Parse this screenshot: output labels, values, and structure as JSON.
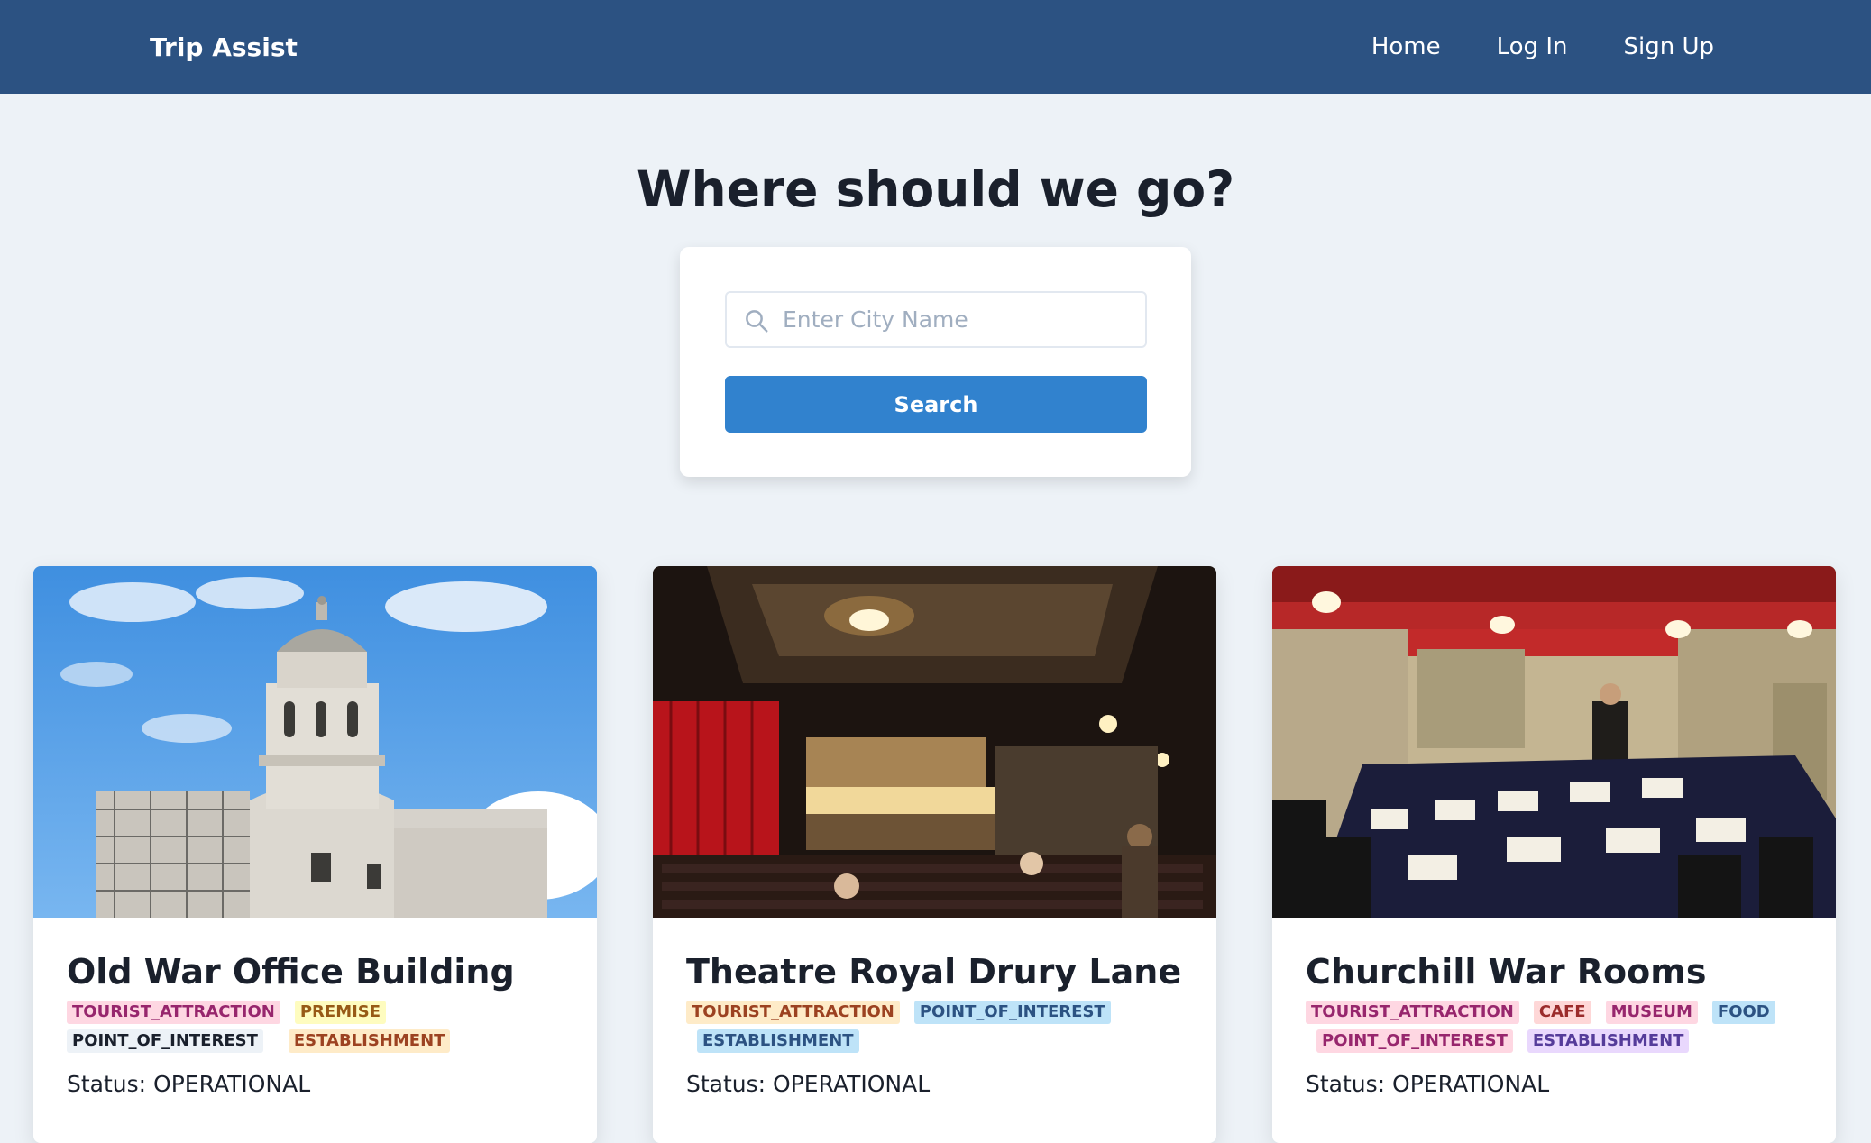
{
  "nav": {
    "brand": "Trip Assist",
    "links": [
      "Home",
      "Log In",
      "Sign Up"
    ]
  },
  "hero": {
    "title": "Where should we go?"
  },
  "search": {
    "placeholder": "Enter City Name",
    "value": "",
    "button_label": "Search"
  },
  "places": [
    {
      "name": "Old War Office Building",
      "tags": [
        {
          "label": "TOURIST_ATTRACTION",
          "color": "#fed7e2"
        },
        {
          "label": "PREMISE",
          "color": "#fefcbf"
        },
        {
          "label": "POINT_OF_INTEREST",
          "color": "#edf2f7"
        },
        {
          "label": "ESTABLISHMENT",
          "color": "#feebc8"
        }
      ],
      "status": "Status: OPERATIONAL"
    },
    {
      "name": "Theatre Royal Drury Lane",
      "tags": [
        {
          "label": "TOURIST_ATTRACTION",
          "color": "#feebc8"
        },
        {
          "label": "POINT_OF_INTEREST",
          "color": "#bee3f8"
        },
        {
          "label": "ESTABLISHMENT",
          "color": "#bee3f8"
        }
      ],
      "status": "Status: OPERATIONAL"
    },
    {
      "name": "Churchill War Rooms",
      "tags": [
        {
          "label": "TOURIST_ATTRACTION",
          "color": "#fed7e2"
        },
        {
          "label": "CAFE",
          "color": "#fed7d7"
        },
        {
          "label": "MUSEUM",
          "color": "#fed7e2"
        },
        {
          "label": "FOOD",
          "color": "#bee3f8"
        },
        {
          "label": "POINT_OF_INTEREST",
          "color": "#fed7e2"
        },
        {
          "label": "ESTABLISHMENT",
          "color": "#e9d8fd"
        }
      ],
      "status": "Status: OPERATIONAL"
    }
  ]
}
